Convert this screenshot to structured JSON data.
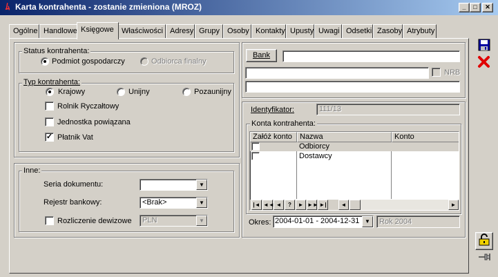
{
  "window": {
    "title": "Karta kontrahenta - zostanie zmieniona (MROZ)"
  },
  "tabs": [
    "Ogólne",
    "Handlowe",
    "Księgowe",
    "Właściwości",
    "Adresy",
    "Grupy",
    "Osoby",
    "Kontakty",
    "Upusty",
    "Uwagi",
    "Odsetki",
    "Zasoby",
    "Atrybuty"
  ],
  "active_tab": "Księgowe",
  "status": {
    "legend": "Status kontrahenta:",
    "options": [
      {
        "label": "Podmiot gospodarczy",
        "selected": true,
        "enabled": true
      },
      {
        "label": "Odbiorca finalny",
        "selected": false,
        "enabled": false
      }
    ]
  },
  "typ": {
    "legend": "Typ kontrahenta:",
    "options": [
      {
        "label": "Krajowy",
        "selected": true
      },
      {
        "label": "Unijny",
        "selected": false
      },
      {
        "label": "Pozaunijny",
        "selected": false
      }
    ]
  },
  "checks": [
    {
      "label": "Rolnik Ryczałtowy",
      "checked": false
    },
    {
      "label": "Jednostka powiązana",
      "checked": false
    },
    {
      "label": "Płatnik Vat",
      "checked": true
    }
  ],
  "inne": {
    "legend": "Inne:",
    "seria_label": "Seria dokumentu:",
    "seria_value": "",
    "rejestr_label": "Rejestr bankowy:",
    "rejestr_value": "<Brak>",
    "rozliczenie_label": "Rozliczenie dewizowe",
    "rozliczenie_checked": false,
    "waluta_value": "PLN"
  },
  "bank": {
    "button": "Bank",
    "field1": "",
    "field2": "",
    "nrb_label": "NRB",
    "nrb_checked": false,
    "field3": ""
  },
  "identyfikator": {
    "label": "Identyfikator:",
    "value": "111/13"
  },
  "konta": {
    "legend": "Konta kontrahenta:",
    "columns": [
      "Załóż konto",
      "Nazwa",
      "Konto"
    ],
    "rows": [
      {
        "zaloz": false,
        "nazwa": "Odbiorcy",
        "konto": ""
      },
      {
        "zaloz": false,
        "nazwa": "Dostawcy",
        "konto": ""
      }
    ],
    "nav": [
      "|◄",
      "◄◄",
      "◄",
      "?",
      "►",
      "►►",
      "►|"
    ]
  },
  "okres": {
    "label": "Okres:",
    "value": "2004-01-01 - 2004-12-31",
    "rok": "Rok 2004"
  },
  "icons": {
    "save": "save-icon",
    "cancel": "cancel-icon",
    "lock": "lock-icon",
    "pin": "pin-icon"
  },
  "colors": {
    "title_start": "#0a246a",
    "title_end": "#a6caf0",
    "cancel": "#e00000",
    "save": "#0000a0"
  }
}
